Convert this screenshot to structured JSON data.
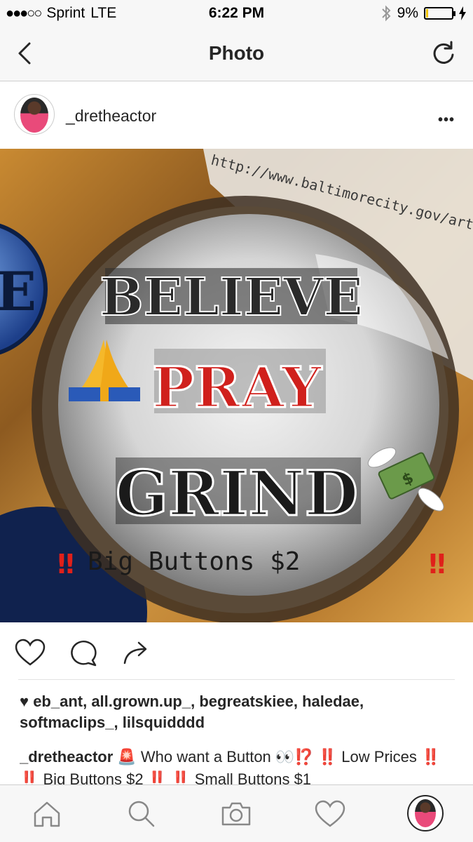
{
  "status_bar": {
    "carrier": "Sprint",
    "network": "LTE",
    "time": "6:22 PM",
    "battery": "9%",
    "battery_level": 0.09
  },
  "nav": {
    "title": "Photo"
  },
  "post": {
    "username": "_dretheactor",
    "image_text": {
      "line1": "BELIEVE",
      "line2": "PRAY",
      "line3": "GRIND",
      "footer": "Big Buttons $2",
      "url": "http://www.baltimorecity.gov/arts/CookieA"
    },
    "likes": "eb_ant, all.grown.up_, begreatskiee, haledae, softmaclips_, lilsquidddd",
    "caption_user": "_dretheactor",
    "caption_text": "🚨 Who want a Button 👀⁉️ ‼️ Low Prices ‼️ ‼️ Big Buttons $2 ‼️ ‼️ Small Buttons $1"
  },
  "colors": {
    "bar_bg": "#f7f7f7",
    "battery_fill": "#f5c400",
    "pray_red": "#d0201c"
  }
}
